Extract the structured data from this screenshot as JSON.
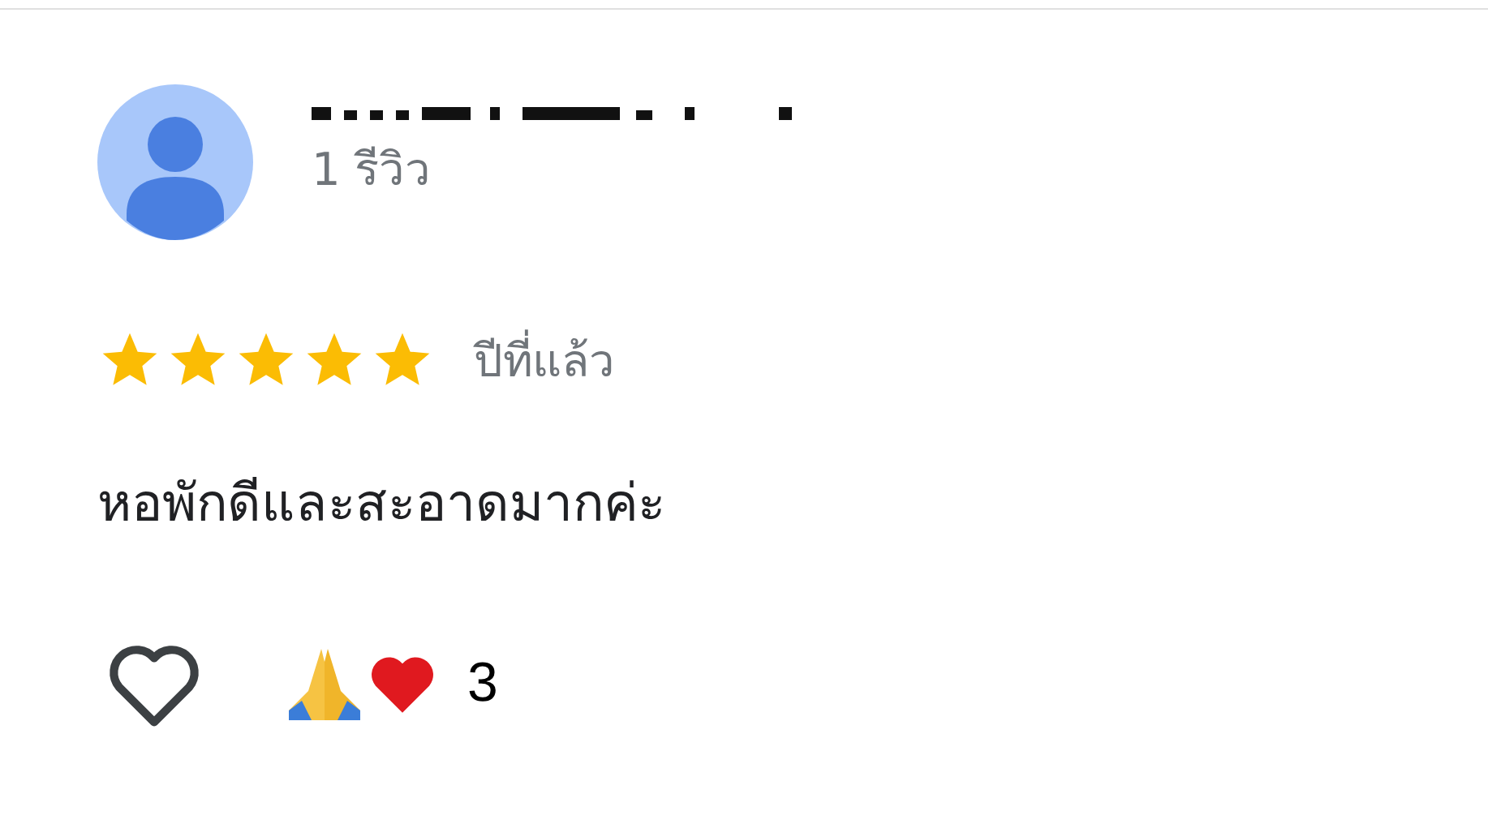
{
  "review": {
    "review_count": "1 รีวิว",
    "stars": 5,
    "time": "ปีที่แล้ว",
    "text": "หอพักดีและสะอาดมากค่ะ",
    "liked": false,
    "reaction_count": "3"
  }
}
